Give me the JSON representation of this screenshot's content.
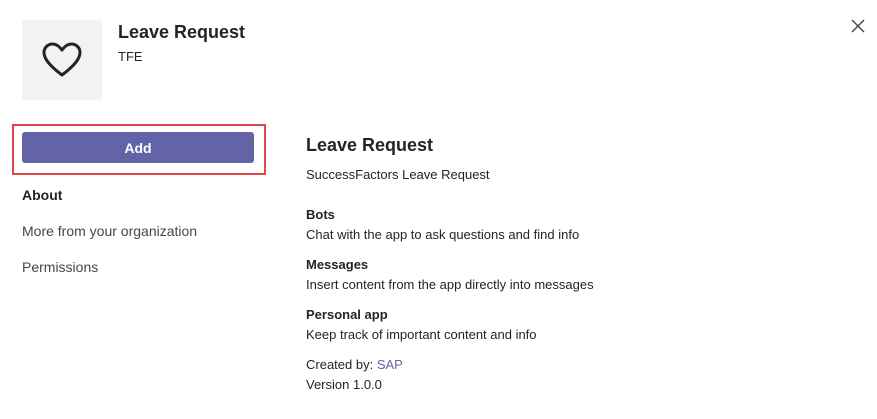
{
  "app": {
    "name": "Leave Request",
    "publisher": "TFE",
    "icon": "heart-icon"
  },
  "actions": {
    "add_label": "Add",
    "highlight_color": "#e0474c",
    "accent_color": "#6264a7"
  },
  "nav": {
    "items": [
      {
        "label": "About",
        "active": true
      },
      {
        "label": "More from your organization",
        "active": false
      },
      {
        "label": "Permissions",
        "active": false
      }
    ]
  },
  "details": {
    "title": "Leave Request",
    "description": "SuccessFactors Leave Request",
    "capabilities": [
      {
        "heading": "Bots",
        "text": "Chat with the app to ask questions and find info"
      },
      {
        "heading": "Messages",
        "text": "Insert content from the app directly into messages"
      },
      {
        "heading": "Personal app",
        "text": "Keep track of important content and info"
      }
    ],
    "created_by_label": "Created by:",
    "created_by_name": "SAP",
    "version": "Version 1.0.0"
  }
}
